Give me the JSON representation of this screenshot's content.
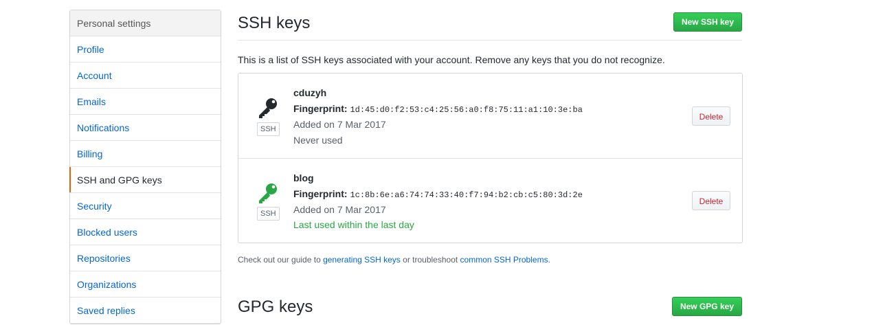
{
  "sidebar": {
    "header": "Personal settings",
    "items": [
      {
        "label": "Profile",
        "selected": false
      },
      {
        "label": "Account",
        "selected": false
      },
      {
        "label": "Emails",
        "selected": false
      },
      {
        "label": "Notifications",
        "selected": false
      },
      {
        "label": "Billing",
        "selected": false
      },
      {
        "label": "SSH and GPG keys",
        "selected": true
      },
      {
        "label": "Security",
        "selected": false
      },
      {
        "label": "Blocked users",
        "selected": false
      },
      {
        "label": "Repositories",
        "selected": false
      },
      {
        "label": "Organizations",
        "selected": false
      },
      {
        "label": "Saved replies",
        "selected": false
      }
    ]
  },
  "ssh": {
    "title": "SSH keys",
    "new_button": "New SSH key",
    "intro": "This is a list of SSH keys associated with your account. Remove any keys that you do not recognize.",
    "keys": [
      {
        "name": "cduzyh",
        "fingerprint_label": "Fingerprint:",
        "fingerprint": "1d:45:d0:f2:53:c4:25:56:a0:f8:75:11:a1:10:3e:ba",
        "added": "Added on 7 Mar 2017",
        "usage": "Never used",
        "badge": "SSH",
        "icon": "key-icon",
        "icon_color": "#24292e",
        "delete_label": "Delete"
      },
      {
        "name": "blog",
        "fingerprint_label": "Fingerprint:",
        "fingerprint": "1c:8b:6e:a6:74:74:33:40:f7:94:b2:cb:c5:80:3d:2e",
        "added": "Added on 7 Mar 2017",
        "usage": "Last used within the last day",
        "badge": "SSH",
        "icon": "key-icon",
        "icon_color": "#28a745",
        "delete_label": "Delete"
      }
    ],
    "guide": {
      "prefix": "Check out our guide to ",
      "link1": "generating SSH keys",
      "middle": " or troubleshoot ",
      "link2": "common SSH Problems",
      "suffix": "."
    }
  },
  "gpg": {
    "title": "GPG keys",
    "new_button": "New GPG key"
  }
}
